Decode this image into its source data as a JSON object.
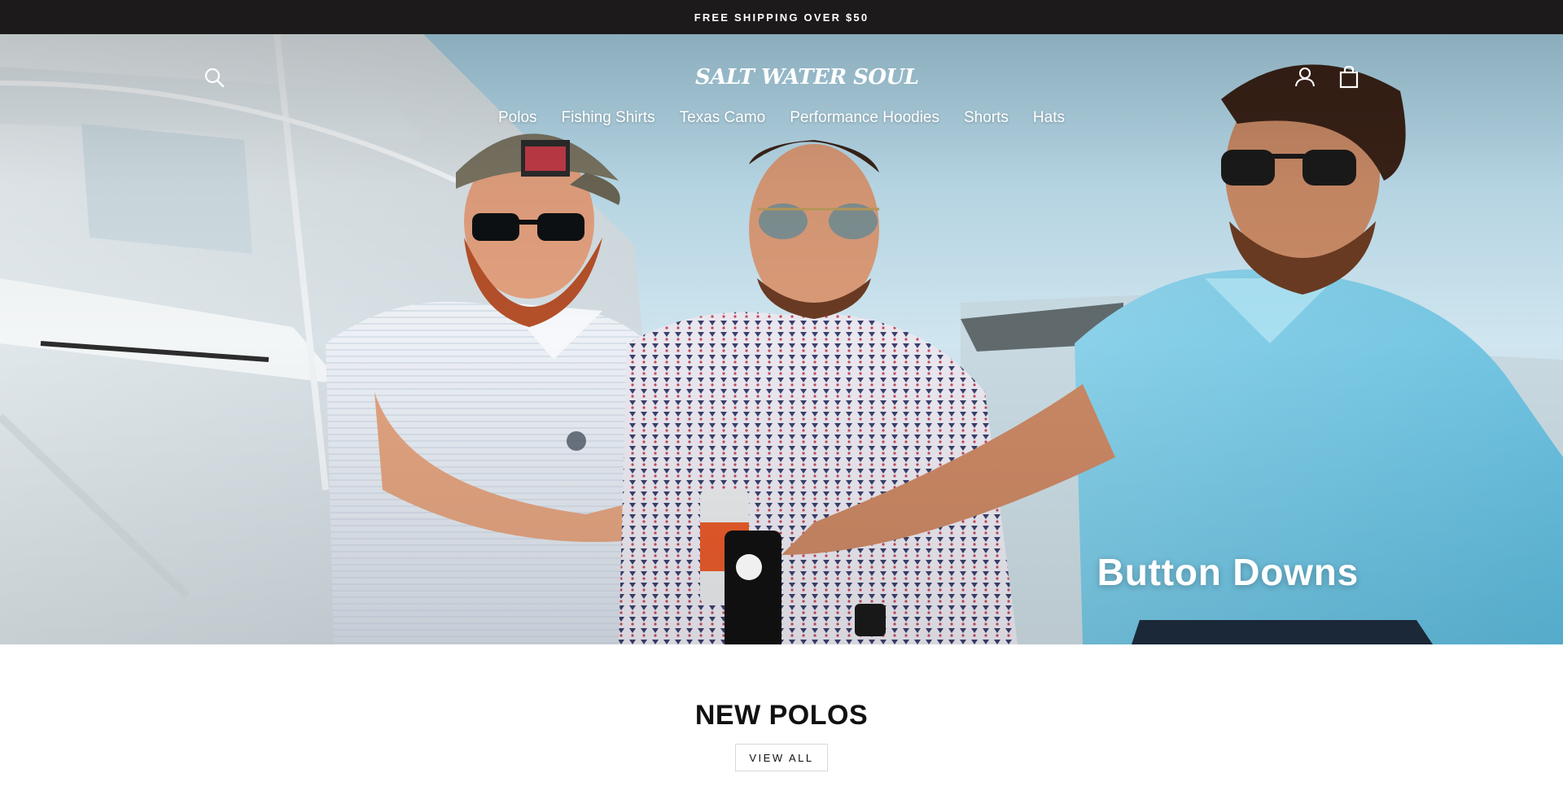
{
  "announcement": {
    "text": "FREE SHIPPING OVER $50"
  },
  "header": {
    "logo_text": "SALT WATER SOUL",
    "icons": {
      "search": "search-icon",
      "account": "user-icon",
      "cart": "shopping-bag-icon"
    }
  },
  "nav": {
    "items": [
      {
        "label": "Polos"
      },
      {
        "label": "Fishing Shirts"
      },
      {
        "label": "Texas Camo"
      },
      {
        "label": "Performance Hoodies"
      },
      {
        "label": "Shorts"
      },
      {
        "label": "Hats"
      }
    ]
  },
  "hero": {
    "title": "Button Downs"
  },
  "featured": {
    "title": "NEW POLOS",
    "view_all_label": "VIEW ALL"
  },
  "colors": {
    "announcement_bg": "#1c1a1b",
    "text_on_dark": "#ffffff",
    "body_text": "#111111",
    "button_border": "#d9d9d9"
  }
}
